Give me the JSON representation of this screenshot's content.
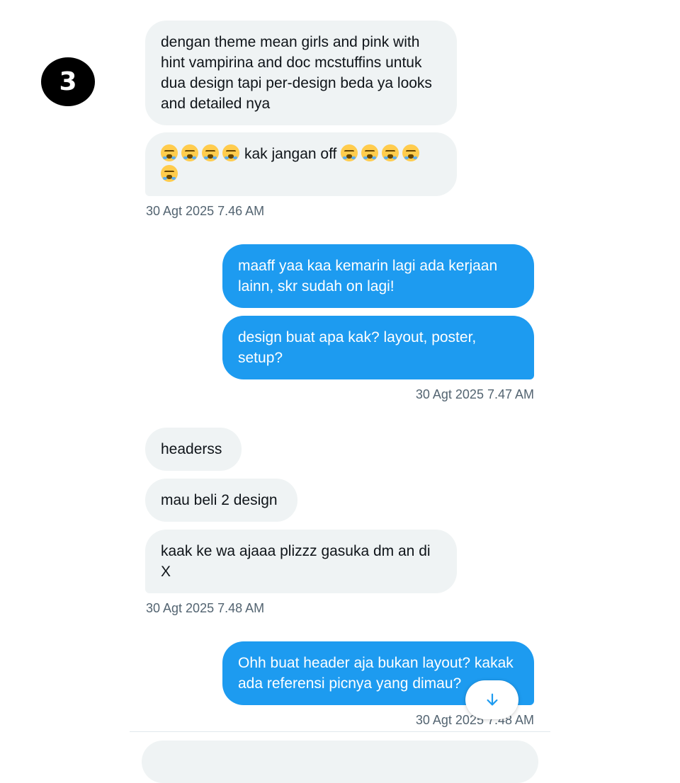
{
  "step_number": "3",
  "messages": {
    "m1": {
      "text": "dengan theme mean girls and pink with hint vampirina and doc mcstuffins untuk dua design tapi per-design beda ya looks and detailed nya"
    },
    "m2": {
      "text": "kak jangan off",
      "emoji": "loudly-crying-face"
    },
    "ts1": "30 Agt 2025 7.46 AM",
    "m3": {
      "text": "maaff yaa kaa kemarin lagi ada kerjaan lainn, skr sudah on lagi!"
    },
    "m4": {
      "text": "design buat apa kak? layout, poster, setup?"
    },
    "ts2": "30 Agt 2025 7.47 AM",
    "m5": {
      "text": "headerss"
    },
    "m6": {
      "text": "mau beli 2 design"
    },
    "m7": {
      "text": "kaak ke wa ajaaa plizzz gasuka dm an di X"
    },
    "ts3": "30 Agt 2025 7.48 AM",
    "m8": {
      "text": "Ohh buat header aja bukan layout? kakak ada referensi picnya yang dimau?"
    },
    "ts4": "30 Agt 2025 7.48 AM"
  },
  "scroll_button": {
    "icon": "arrow-down-icon"
  },
  "colors": {
    "incoming_bubble": "#eff3f4",
    "outgoing_bubble": "#1d9bf0",
    "timestamp": "#536471",
    "accent": "#1d9bf0"
  }
}
